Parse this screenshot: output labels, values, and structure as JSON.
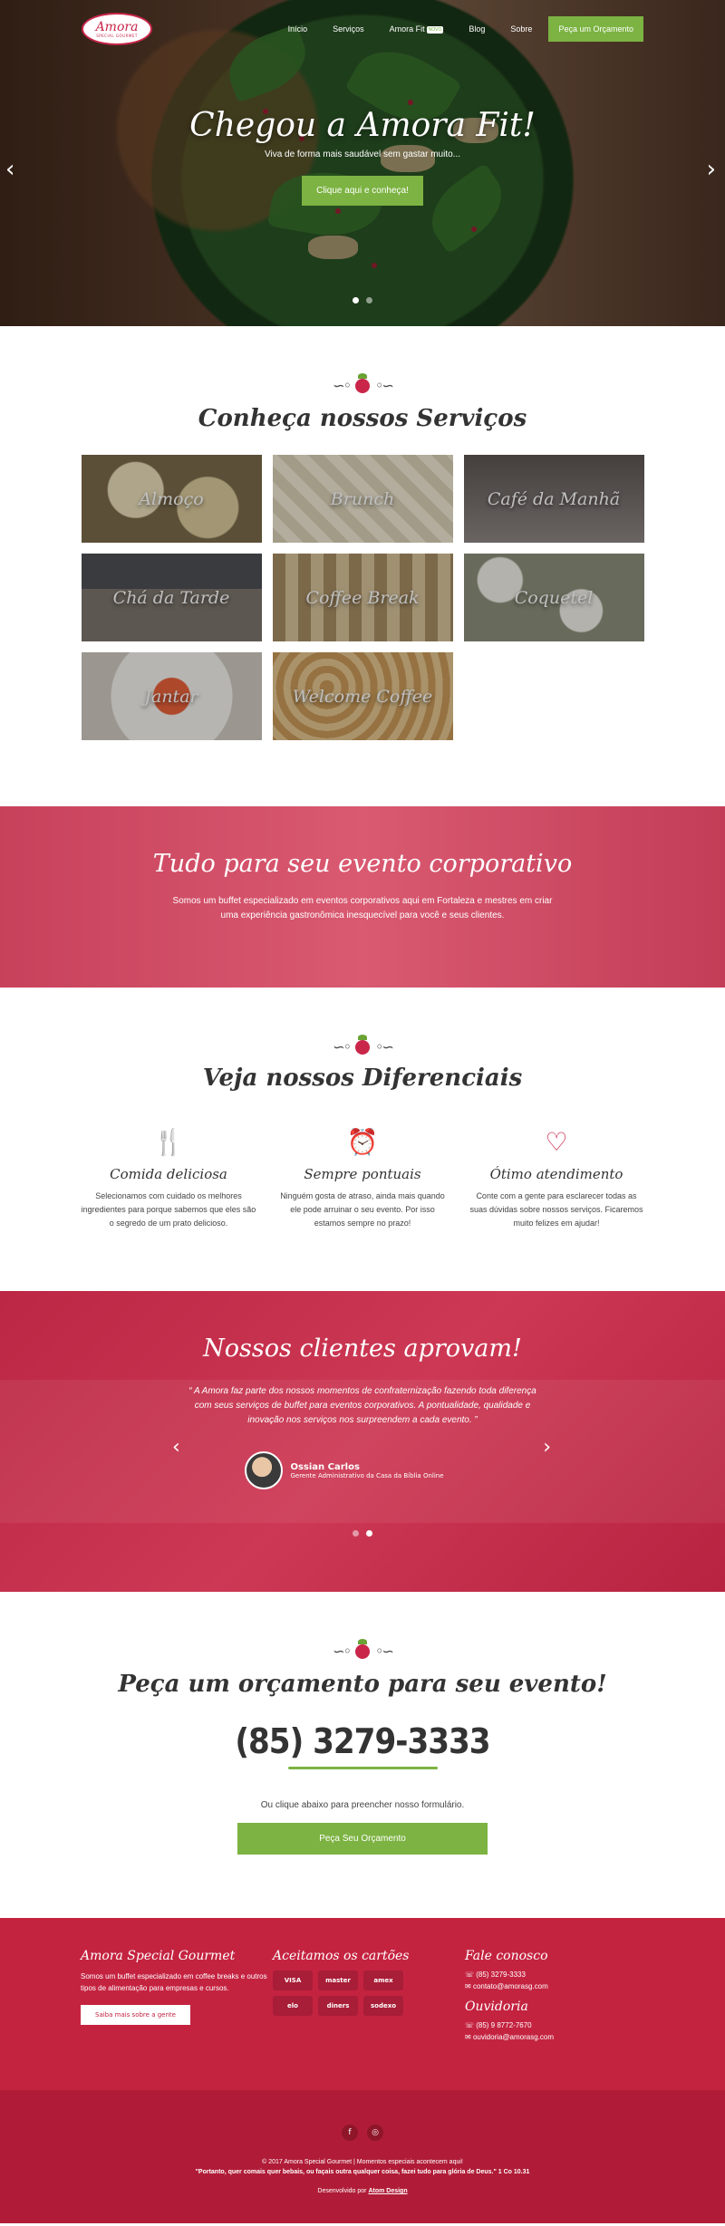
{
  "header": {
    "logo_text": "Amora",
    "logo_sub": "SPECIAL GOURMET",
    "nav": [
      "Início",
      "Serviços",
      "Amora Fit",
      "Blog",
      "Sobre"
    ],
    "nav_badge": "NOVO",
    "cta": "Peça um Orçamento"
  },
  "hero": {
    "title": "Chegou a Amora Fit!",
    "subtitle": "Viva de forma mais saudável sem gastar muito...",
    "button": "Clique aqui e conheça!"
  },
  "services": {
    "title": "Conheça nossos Serviços",
    "items": [
      "Almoço",
      "Brunch",
      "Café da Manhã",
      "Chá da Tarde",
      "Coffee Break",
      "Coquetel",
      "Jantar",
      "Welcome Coffee"
    ]
  },
  "corporate": {
    "title": "Tudo para seu evento corporativo",
    "text": "Somos um buffet especializado em eventos corporativos aqui em Fortaleza e mestres em criar uma experiência gastronômica inesquecível para você e seus clientes."
  },
  "diferenciais": {
    "title": "Veja nossos Diferenciais",
    "items": [
      {
        "icon": "cutlery-icon",
        "title": "Comida deliciosa",
        "text": "Selecionamos com cuidado os melhores ingredientes para porque sabemos que eles são o segredo de um prato delicioso."
      },
      {
        "icon": "alarm-clock-icon",
        "title": "Sempre pontuais",
        "text": "Ninguém gosta de atraso, ainda mais quando ele pode arruinar o seu evento. Por isso estamos sempre no prazo!"
      },
      {
        "icon": "heart-icon",
        "title": "Ótimo atendimento",
        "text": "Conte com a gente para esclarecer todas as suas dúvidas sobre nossos serviços. Ficaremos muito felizes em ajudar!"
      }
    ]
  },
  "clients": {
    "title": "Nossos clientes aprovam!",
    "quote": "“ A Amora faz parte dos nossos momentos de confraternização fazendo toda diferença com seus serviços de buffet para eventos corporativos. A pontualidade, qualidade e inovação nos serviços nos surpreendem a cada evento. ”",
    "author_name": "Ossian Carlos",
    "author_role": "Gerente Administrativo da Casa da Bíblia Online"
  },
  "orcamento": {
    "title": "Peça um orçamento para seu evento!",
    "phone": "(85) 3279-3333",
    "text": "Ou clique abaixo para preencher nosso formulário.",
    "button": "Peça Seu Orçamento"
  },
  "footer": {
    "about_title": "Amora Special Gourmet",
    "about_text": "Somos um buffet especializado em coffee breaks e outros tipos de alimentação para empresas e cursos.",
    "about_button": "Saiba mais sobre a gente",
    "cards_title": "Aceitamos os cartões",
    "cards": [
      "VISA",
      "master",
      "amex",
      "elo",
      "diners",
      "sodexo"
    ],
    "contact_title": "Fale conosco",
    "contact_phone": "(85) 3279-3333",
    "contact_email": "contato@amorasg.com",
    "ouvidoria_title": "Ouvidoria",
    "ouvidoria_phone": "(85) 9 8772-7670",
    "ouvidoria_email": "ouvidoria@amorasg.com",
    "copyright": "© 2017 Amora Special Gourmet | Momentos especiais acontecem aqui!",
    "verse": "\"Portanto, quer comais quer bebais, ou façais outra qualquer coisa, fazei tudo para glória de Deus.\" 1 Co 10.31",
    "dev_prefix": "Desenvolvido por",
    "dev_name": "Atom Design"
  },
  "colors": {
    "accent": "#c9264a",
    "green": "#7cb342",
    "footer": "#c42340"
  }
}
